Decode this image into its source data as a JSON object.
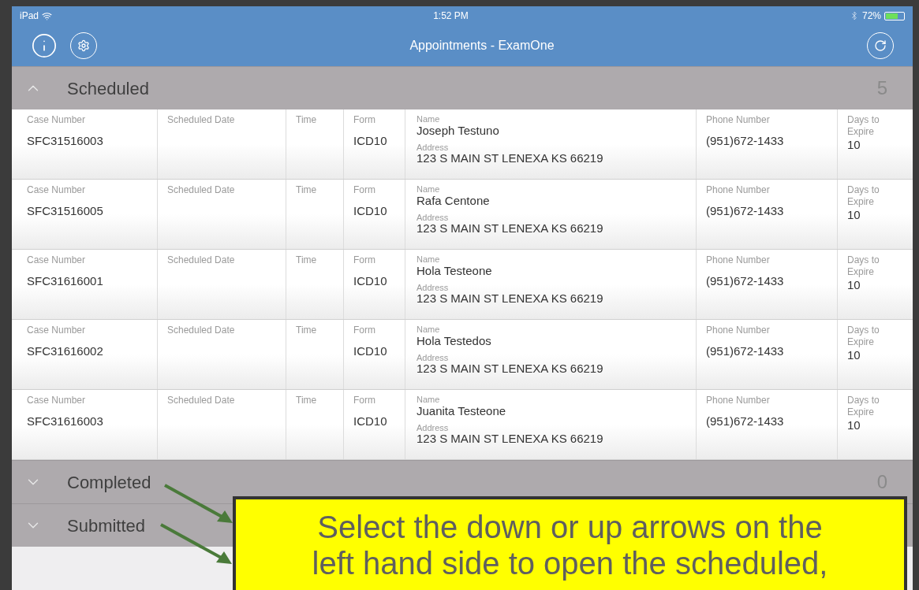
{
  "status_bar": {
    "device": "iPad",
    "time": "1:52 PM",
    "battery": "72%"
  },
  "header": {
    "title": "Appointments - ExamOne"
  },
  "sections": [
    {
      "title": "Scheduled",
      "expanded": true,
      "count": "5",
      "rows": [
        {
          "cells": [
            {
              "label": "Case Number",
              "value": "SFC31516003"
            },
            {
              "label": "Scheduled Date"
            },
            {
              "label": "Time"
            },
            {
              "label": "Form",
              "value": "ICD10"
            },
            {
              "kind": "name",
              "label": "Name",
              "value": "Joseph Testuno",
              "address_label": "Address",
              "address": "123 S MAIN ST LENEXA KS 66219"
            },
            {
              "label": "Phone Number",
              "value": "(951)672-1433"
            },
            {
              "label": "Days to Expire",
              "value": "10"
            }
          ]
        },
        {
          "cells": [
            {
              "label": "Case Number",
              "value": "SFC31516005"
            },
            {
              "label": "Scheduled Date"
            },
            {
              "label": "Time"
            },
            {
              "label": "Form",
              "value": "ICD10"
            },
            {
              "kind": "name",
              "label": "Name",
              "value": "Rafa Centone",
              "address_label": "Address",
              "address": "123 S MAIN ST LENEXA KS 66219"
            },
            {
              "label": "Phone Number",
              "value": "(951)672-1433"
            },
            {
              "label": "Days to Expire",
              "value": "10"
            }
          ]
        },
        {
          "cells": [
            {
              "label": "Case Number",
              "value": "SFC31616001"
            },
            {
              "label": "Scheduled Date"
            },
            {
              "label": "Time"
            },
            {
              "label": "Form",
              "value": "ICD10"
            },
            {
              "kind": "name",
              "label": "Name",
              "value": "Hola Testeone",
              "address_label": "Address",
              "address": "123 S MAIN ST LENEXA KS 66219"
            },
            {
              "label": "Phone Number",
              "value": "(951)672-1433"
            },
            {
              "label": "Days to Expire",
              "value": "10"
            }
          ]
        },
        {
          "cells": [
            {
              "label": "Case Number",
              "value": "SFC31616002"
            },
            {
              "label": "Scheduled Date"
            },
            {
              "label": "Time"
            },
            {
              "label": "Form",
              "value": "ICD10"
            },
            {
              "kind": "name",
              "label": "Name",
              "value": "Hola Testedos",
              "address_label": "Address",
              "address": "123 S MAIN ST LENEXA KS 66219"
            },
            {
              "label": "Phone Number",
              "value": "(951)672-1433"
            },
            {
              "label": "Days to Expire",
              "value": "10"
            }
          ]
        },
        {
          "cells": [
            {
              "label": "Case Number",
              "value": "SFC31616003"
            },
            {
              "label": "Scheduled Date"
            },
            {
              "label": "Time"
            },
            {
              "label": "Form",
              "value": "ICD10"
            },
            {
              "kind": "name",
              "label": "Name",
              "value": "Juanita Testeone",
              "address_label": "Address",
              "address": "123 S MAIN ST LENEXA KS 66219"
            },
            {
              "label": "Phone Number",
              "value": "(951)672-1433"
            },
            {
              "label": "Days to Expire",
              "value": "10"
            }
          ]
        }
      ]
    },
    {
      "title": "Completed",
      "expanded": false,
      "count": "0"
    },
    {
      "title": "Submitted",
      "expanded": false
    }
  ],
  "callout": {
    "lines": [
      "Select the down or up arrows on the",
      "left hand side to open the scheduled,"
    ]
  }
}
